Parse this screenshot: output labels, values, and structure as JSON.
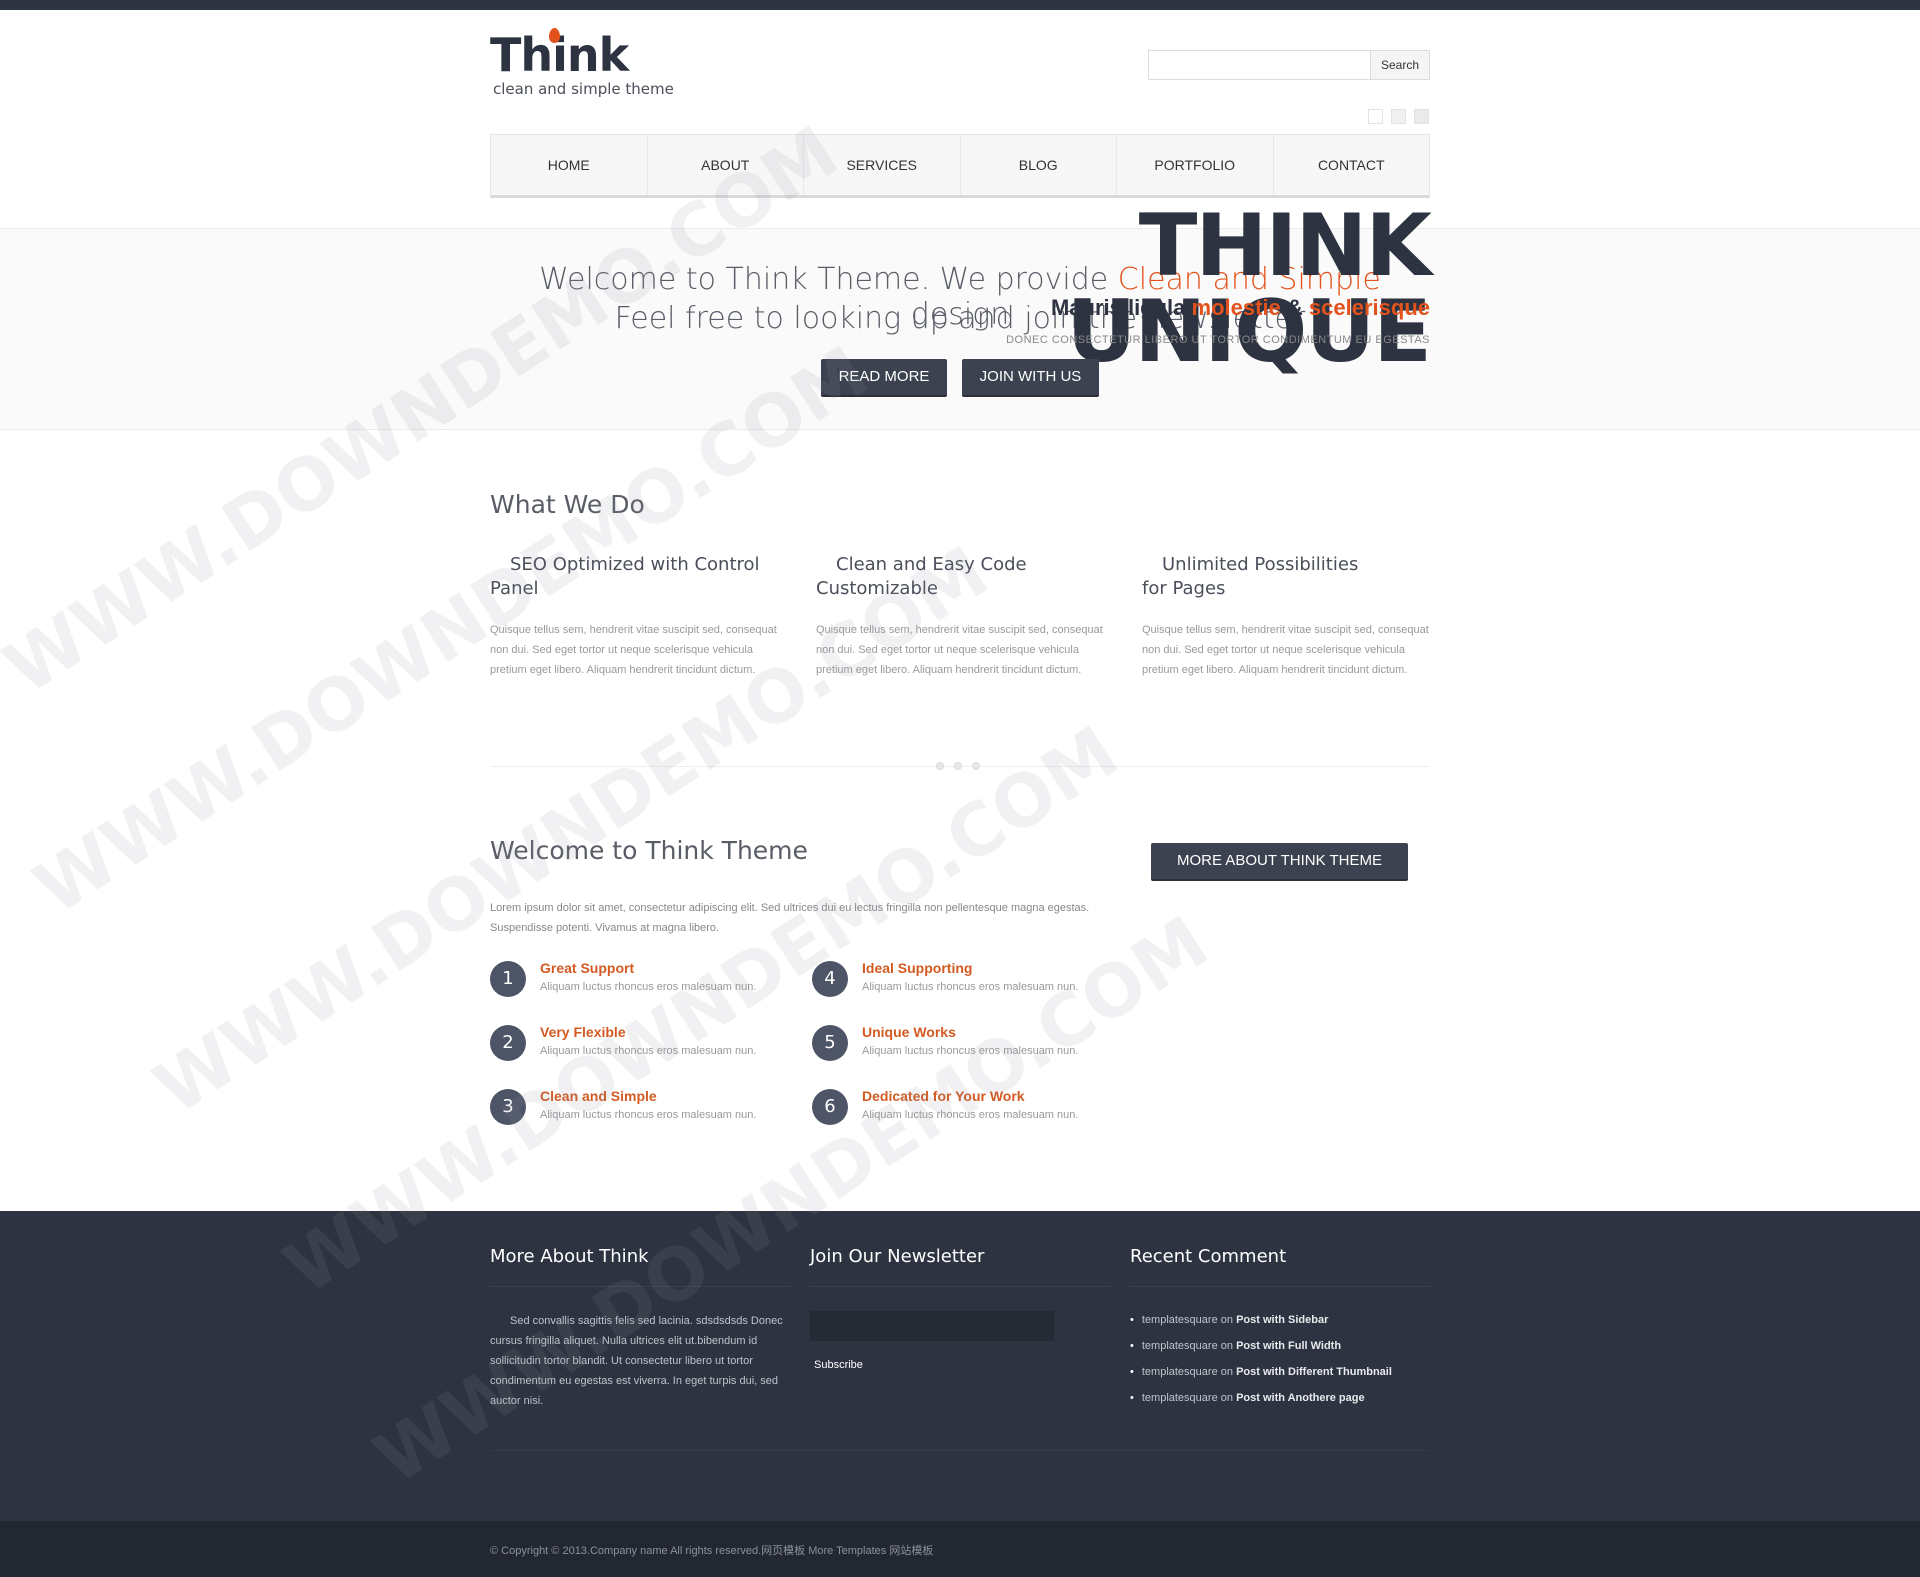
{
  "header": {
    "logo_title": "Think",
    "logo_subtitle": "clean and simple theme",
    "search_button": "Search",
    "search_placeholder": ""
  },
  "nav": [
    "HOME",
    "ABOUT",
    "SERVICES",
    "BLOG",
    "PORTFOLIO",
    "CONTACT"
  ],
  "hero": {
    "big_title": "THINK UNIQUE",
    "welcome_line1_a": "Welcome to Think Theme. We provide ",
    "welcome_line1_accent": "Clean and Simple",
    "welcome_line1_b": " design",
    "welcome_line2": "Feel free to looking up and join the newsletter",
    "tagline_a": "Mauris ligula ",
    "tagline_b": "molestie",
    "tagline_c": " & ",
    "tagline_d": "scelerisque",
    "tagline_small": "DONEC CONSECTETUR LIBERO UT TORTOR CONDIMENTUM EU EGESTAS",
    "read_more": "READ MORE",
    "join": "JOIN WITH US"
  },
  "what_we_do": {
    "heading": "What We Do",
    "features": [
      {
        "title": "SEO Optimized with Control Panel",
        "text": "Quisque tellus sem, hendrerit vitae suscipit sed, consequat non dui. Sed eget tortor ut neque scelerisque vehicula pretium eget libero. Aliquam hendrerit tincidunt dictum."
      },
      {
        "title": "Clean and Easy Code Customizable",
        "text": "Quisque tellus sem, hendrerit vitae suscipit sed, consequat non dui. Sed eget tortor ut neque scelerisque vehicula pretium eget libero. Aliquam hendrerit tincidunt dictum."
      },
      {
        "title": "Unlimited Possibilities for Pages",
        "text": "Quisque tellus sem, hendrerit vitae suscipit sed, consequat non dui. Sed eget tortor ut neque scelerisque vehicula pretium eget libero. Aliquam hendrerit tincidunt dictum."
      }
    ]
  },
  "welcome": {
    "heading": "Welcome to Think Theme",
    "more_button": "MORE ABOUT THINK THEME",
    "intro": "Lorem ipsum dolor sit amet, consectetur adipiscing elit. Sed ultrices dui eu lectus fringilla non pellentesque magna egestas. Suspendisse potenti. Vivamus at magna libero.",
    "items": [
      {
        "num": "1",
        "title": "Great Support",
        "text": "Aliquam luctus rhoncus eros malesuam nun."
      },
      {
        "num": "2",
        "title": "Very Flexible",
        "text": "Aliquam luctus rhoncus eros malesuam nun."
      },
      {
        "num": "3",
        "title": "Clean and Simple",
        "text": "Aliquam luctus rhoncus eros malesuam nun."
      },
      {
        "num": "4",
        "title": "Ideal Supporting",
        "text": "Aliquam luctus rhoncus eros malesuam nun."
      },
      {
        "num": "5",
        "title": "Unique Works",
        "text": "Aliquam luctus rhoncus eros malesuam nun."
      },
      {
        "num": "6",
        "title": "Dedicated for Your Work",
        "text": "Aliquam luctus rhoncus eros malesuam nun."
      }
    ]
  },
  "footer": {
    "about_heading": "More About Think",
    "about_text": "Sed convallis sagittis felis sed lacinia. sdsdsdsds Donec cursus fringilla aliquet. Nulla ultrices elit ut.bibendum id sollicitudin tortor blandit. Ut consectetur libero ut tortor condimentum eu egestas est viverra. In eget turpis dui, sed auctor nisi.",
    "newsletter_heading": "Join Our Newsletter",
    "subscribe": "Subscribe",
    "recent_heading": "Recent Comment",
    "comments": [
      {
        "author": "templatesquare",
        "on": "on",
        "post": "Post with Sidebar"
      },
      {
        "author": "templatesquare",
        "on": "on",
        "post": "Post with Full Width"
      },
      {
        "author": "templatesquare",
        "on": "on",
        "post": "Post with Different Thumbnail"
      },
      {
        "author": "templatesquare",
        "on": "on",
        "post": "Post with Anothere page"
      }
    ],
    "copyright": "© Copyright © 2013.Company name All rights reserved.网页模板 More Templates 网站模板"
  },
  "watermark": "WWW.DOWNDEMO.COM",
  "colors": {
    "accent": "#e2521c",
    "dark": "#2d3340"
  }
}
